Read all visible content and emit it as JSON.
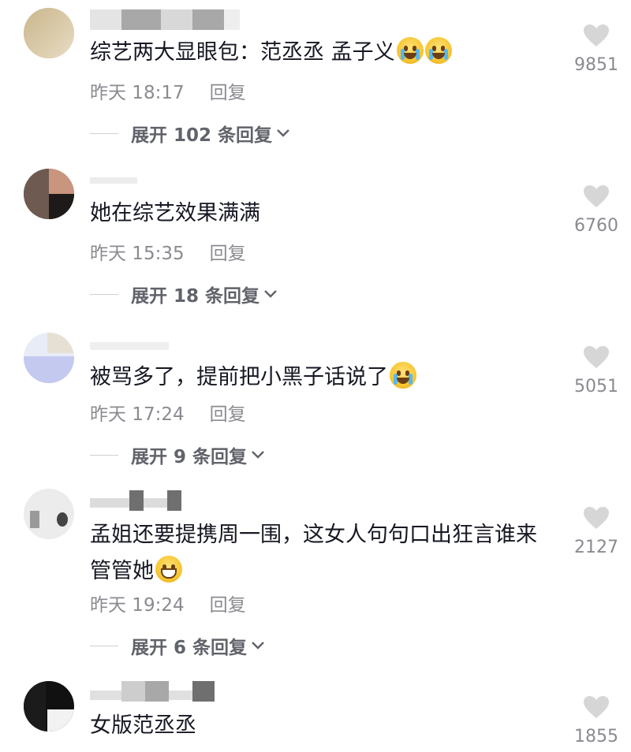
{
  "comments": [
    {
      "text": "综艺两大显眼包：范丞丞  孟子义",
      "emojis": [
        "crying-laughing-emoji",
        "crying-laughing-emoji"
      ],
      "time": "昨天 18:17",
      "reply": "回复",
      "expand": "展开 102 条回复",
      "likes": "9851"
    },
    {
      "text": "她在综艺效果满满",
      "emojis": [],
      "time": "昨天 15:35",
      "reply": "回复",
      "expand": "展开 18 条回复",
      "likes": "6760"
    },
    {
      "text": "被骂多了，提前把小黑子话说了",
      "emojis": [
        "crying-laughing-emoji"
      ],
      "time": "昨天 17:24",
      "reply": "回复",
      "expand": "展开 9 条回复",
      "likes": "5051"
    },
    {
      "text": "孟姐还要提携周一围，这女人句句口出狂言谁来管管她",
      "emojis": [
        "grinning-emoji"
      ],
      "time": "昨天 19:24",
      "reply": "回复",
      "expand": "展开 6 条回复",
      "likes": "2127"
    },
    {
      "text": "女版范丞丞",
      "emojis": [],
      "likes": "1855"
    }
  ],
  "icons": {
    "heart": "heart-icon",
    "chevron": "chevron-down-icon"
  },
  "colors": {
    "text": "#161823",
    "meta": "#8a8b91",
    "expand": "#61636b",
    "heart": "#d6d6d6"
  }
}
